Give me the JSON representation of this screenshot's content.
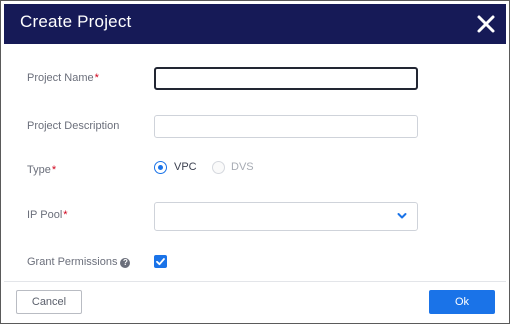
{
  "dialog": {
    "title": "Create Project",
    "close_icon": "close-icon"
  },
  "form": {
    "project_name": {
      "label": "Project Name",
      "required_marker": "*",
      "value": "",
      "placeholder": ""
    },
    "project_description": {
      "label": "Project Description",
      "value": "",
      "placeholder": ""
    },
    "type": {
      "label": "Type",
      "required_marker": "*",
      "options": [
        {
          "label": "VPC",
          "selected": true
        },
        {
          "label": "DVS",
          "selected": false
        }
      ]
    },
    "ip_pool": {
      "label": "IP Pool",
      "required_marker": "*",
      "selected_value": "",
      "icon": "chevron-down-icon"
    },
    "grant_permissions": {
      "label": "Grant Permissions",
      "help_icon": "?",
      "checked": true
    }
  },
  "footer": {
    "cancel_label": "Cancel",
    "ok_label": "Ok"
  },
  "colors": {
    "header_bg": "#161a57",
    "accent": "#1a73e8",
    "required": "#d0021b",
    "label_text": "#6b6f7b"
  }
}
